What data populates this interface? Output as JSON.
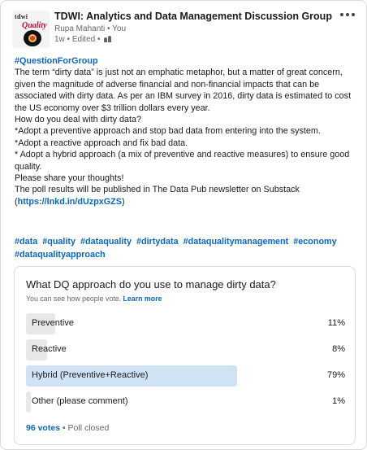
{
  "post": {
    "group_name": "TDWI: Analytics and Data Management Discussion Group",
    "author_line": "Rupa Mahanti • You",
    "meta_line": "1w • Edited •",
    "logo_text": "tdwi",
    "logo_sub": "Quality",
    "hashtag_heading": "#QuestionForGroup",
    "paragraphs": [
      "The term “dirty data” is just not an emphatic metaphor, but a matter of great concern, given the magnitude of adverse financial and non-financial impacts that can be associated with dirty data. As per an IBM survey in 2016, dirty data is estimated to cost the US economy over $3 trillion dollars every year.",
      "How do you deal with dirty data?",
      "*Adopt a preventive approach and stop bad data from entering into the system.",
      "*Adopt a reactive approach and fix bad data.",
      "* Adopt a hybrid approach (a mix of preventive and reactive measures) to ensure good quality.",
      "Please share your thoughts!",
      "The poll results will be published in The Data Pub newsletter on Substack"
    ],
    "link_open": "(",
    "link_text": "https://lnkd.in/dUzpxGZS",
    "link_close": ")",
    "hashtags": [
      "#data",
      "#quality",
      "#dataquality",
      "#dirtydata",
      "#dataqualitymanagement",
      "#economy",
      "#dataqualityapproach"
    ]
  },
  "poll": {
    "question": "What DQ approach do you use to manage dirty data?",
    "note": "You can see how people vote.",
    "learn_more": "Learn more",
    "options": [
      {
        "label": "Preventive",
        "percent": "11%",
        "fraction": 0.11
      },
      {
        "label": "Reactive",
        "percent": "8%",
        "fraction": 0.08
      },
      {
        "label": "Hybrid (Preventive+Reactive)",
        "percent": "79%",
        "fraction": 0.79
      },
      {
        "label": "Other (please comment)",
        "percent": "1%",
        "fraction": 0.01
      }
    ],
    "votes": "96 votes",
    "status": "• Poll closed"
  },
  "colors": {
    "link": "#0a66c2",
    "bar": "#e8e8e8",
    "bar_top": "#cfe3f5"
  },
  "icons": {
    "more": "ellipsis-icon",
    "visibility": "group-members-icon"
  }
}
